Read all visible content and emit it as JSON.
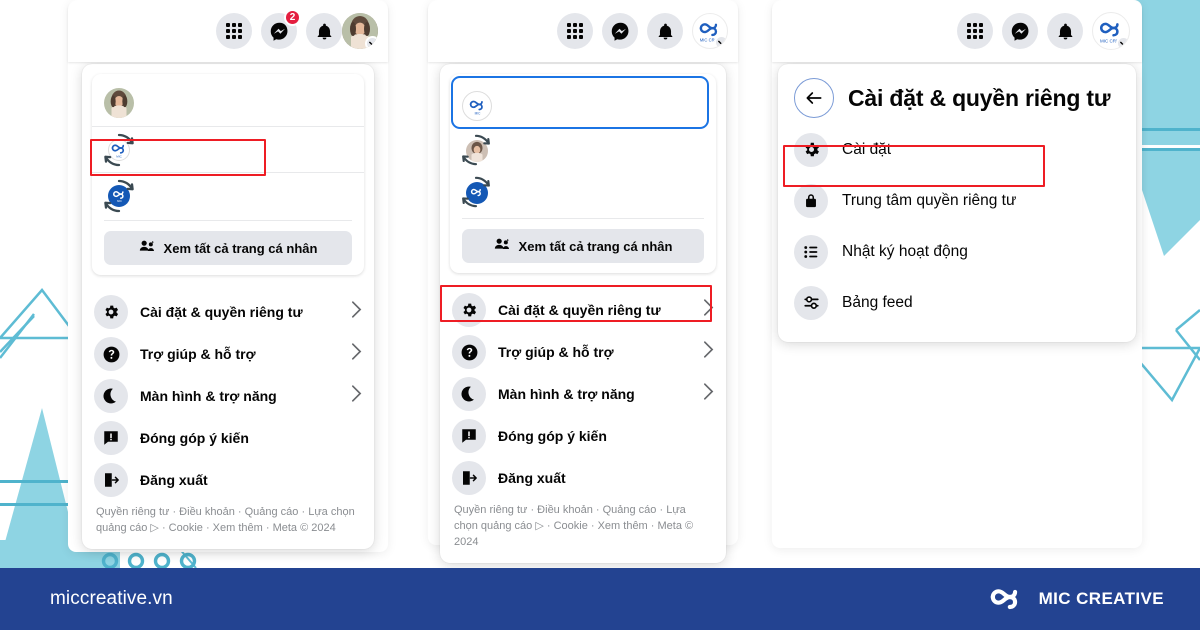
{
  "page": {
    "brand_accent": "#234391",
    "decor_color": "#8ed4e3",
    "decor_line_color": "#4fb3cc",
    "highlight_color": "#ee1d24",
    "focus_color": "#1b74e4"
  },
  "footer": {
    "url": "miccreative.vn",
    "brand_name": "MIC CREATIVE",
    "logo_icon": "mic-creative-infinity-logo"
  },
  "panel1": {
    "header_icons": [
      {
        "name": "menu-grid-icon",
        "badge": null
      },
      {
        "name": "messenger-icon",
        "badge": "2"
      },
      {
        "name": "notifications-bell-icon",
        "badge": null
      },
      {
        "name": "profile-avatar-photo",
        "badge": null
      }
    ],
    "accounts": [
      {
        "icon": "user-avatar-photo",
        "name": ""
      },
      {
        "icon": "mic-creative-page-logo",
        "name": ""
      },
      {
        "icon": "mic-creative-blue-logo",
        "name": ""
      }
    ],
    "see_all_label": "Xem tất cả trang cá nhân",
    "see_all_icon": "people-switch-icon",
    "menu": [
      {
        "icon": "gear-icon",
        "label": "Cài đặt & quyền riêng tư",
        "chevron": true
      },
      {
        "icon": "question-circle-icon",
        "label": "Trợ giúp & hỗ trợ",
        "chevron": true
      },
      {
        "icon": "moon-icon",
        "label": "Màn hình & trợ năng",
        "chevron": true
      },
      {
        "icon": "feedback-icon",
        "label": "Đóng góp ý kiến",
        "chevron": false
      },
      {
        "icon": "logout-icon",
        "label": "Đăng xuất",
        "chevron": false
      }
    ],
    "legal": "Quyền riêng tư · Điều khoản · Quảng cáo · Lựa chọn quảng cáo ▷ · Cookie · Xem thêm · Meta © 2024"
  },
  "panel2": {
    "header_icons": [
      {
        "name": "menu-grid-icon",
        "badge": null
      },
      {
        "name": "messenger-icon",
        "badge": null
      },
      {
        "name": "notifications-bell-icon",
        "badge": null
      },
      {
        "name": "mic-creative-avatar-logo",
        "badge": null
      }
    ],
    "accounts": [
      {
        "icon": "mic-creative-page-logo",
        "name": "",
        "selected": true
      },
      {
        "icon": "user-avatar-photo",
        "name": "",
        "selected": false
      },
      {
        "icon": "mic-creative-blue-logo",
        "name": "",
        "selected": false
      }
    ],
    "see_all_label": "Xem tất cả trang cá nhân",
    "see_all_icon": "people-switch-icon",
    "menu": [
      {
        "icon": "gear-icon",
        "label": "Cài đặt & quyền riêng tư",
        "chevron": true
      },
      {
        "icon": "question-circle-icon",
        "label": "Trợ giúp & hỗ trợ",
        "chevron": true
      },
      {
        "icon": "moon-icon",
        "label": "Màn hình & trợ năng",
        "chevron": true
      },
      {
        "icon": "feedback-icon",
        "label": "Đóng góp ý kiến",
        "chevron": false
      },
      {
        "icon": "logout-icon",
        "label": "Đăng xuất",
        "chevron": false
      }
    ],
    "legal": "Quyền riêng tư · Điều khoản · Quảng cáo · Lựa chọn quảng cáo ▷ · Cookie · Xem thêm · Meta © 2024"
  },
  "panel3": {
    "header_icons": [
      {
        "name": "menu-grid-icon",
        "badge": null
      },
      {
        "name": "messenger-icon",
        "badge": null
      },
      {
        "name": "notifications-bell-icon",
        "badge": null
      },
      {
        "name": "mic-creative-avatar-logo",
        "badge": null
      }
    ],
    "back_icon": "back-arrow-icon",
    "title": "Cài đặt & quyền riêng tư",
    "menu": [
      {
        "icon": "gear-icon",
        "label": "Cài đặt"
      },
      {
        "icon": "lock-icon",
        "label": "Trung tâm quyền riêng tư"
      },
      {
        "icon": "activity-list-icon",
        "label": "Nhật ký hoạt động"
      },
      {
        "icon": "feed-sliders-icon",
        "label": "Bảng feed"
      }
    ]
  }
}
